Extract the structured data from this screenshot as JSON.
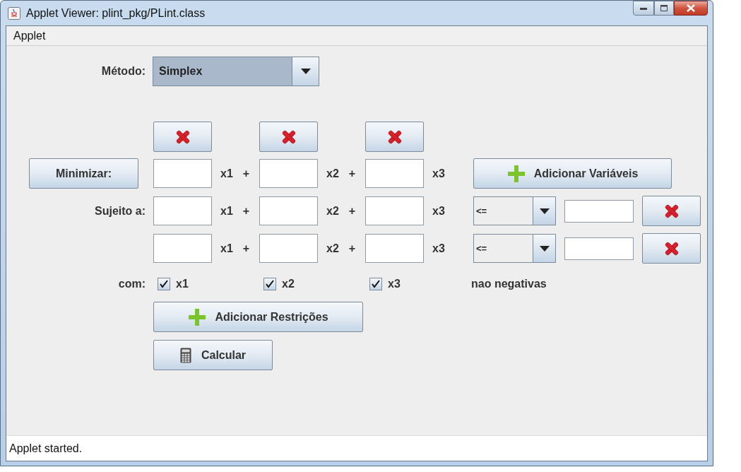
{
  "window": {
    "title": "Applet Viewer: plint_pkg/PLint.class"
  },
  "menu": [
    {
      "label": "Applet"
    }
  ],
  "method": {
    "label": "Método:",
    "value": "Simplex"
  },
  "objective": {
    "button": "Minimizar:",
    "terms": [
      {
        "var": "x1",
        "op": "+"
      },
      {
        "var": "x2",
        "op": "+"
      },
      {
        "var": "x3"
      }
    ]
  },
  "add_variables_button": "Adicionar Variáveis",
  "constraints": {
    "label": "Sujeito a:",
    "rows": [
      {
        "terms": [
          {
            "var": "x1",
            "op": "+"
          },
          {
            "var": "x2",
            "op": "+"
          },
          {
            "var": "x3"
          }
        ],
        "relation": "<="
      },
      {
        "terms": [
          {
            "var": "x1",
            "op": "+"
          },
          {
            "var": "x2",
            "op": "+"
          },
          {
            "var": "x3"
          }
        ],
        "relation": "<="
      }
    ]
  },
  "nonnegativity": {
    "label": "com:",
    "checks": [
      {
        "label": "x1",
        "checked": true
      },
      {
        "label": "x2",
        "checked": true
      },
      {
        "label": "x3",
        "checked": true
      }
    ],
    "suffix": "nao negativas"
  },
  "add_constraints_button": "Adicionar Restrições",
  "calculate_button": "Calcular",
  "status_bar": "Applet started."
}
